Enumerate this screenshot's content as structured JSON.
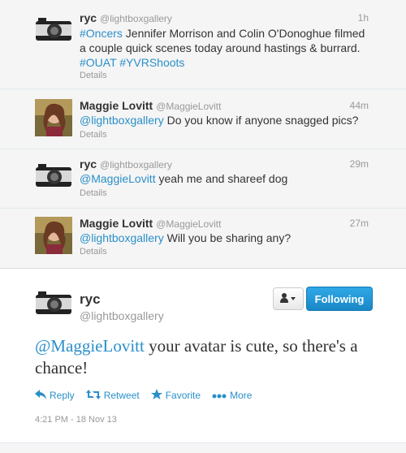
{
  "conversation": [
    {
      "name": "ryc",
      "handle": "@lightboxgallery",
      "time": "1h",
      "text_parts": [
        "#Oncers",
        " Jennifer Morrison and Colin O'Donoghue filmed a couple quick scenes today around hastings & burrard. ",
        "#OUAT #YVRShoots"
      ],
      "details": "Details",
      "avatar": "camera-avatar"
    },
    {
      "name": "Maggie Lovitt",
      "handle": "@MaggieLovitt",
      "time": "44m",
      "text_parts": [
        "@lightboxgallery",
        " Do you know if anyone snagged pics?"
      ],
      "details": "Details",
      "avatar": "person-avatar"
    },
    {
      "name": "ryc",
      "handle": "@lightboxgallery",
      "time": "29m",
      "text_parts": [
        "@MaggieLovitt",
        " yeah me and shareef dog"
      ],
      "details": "Details",
      "avatar": "camera-avatar"
    },
    {
      "name": "Maggie Lovitt",
      "handle": "@MaggieLovitt",
      "time": "27m",
      "text_parts": [
        "@lightboxgallery",
        " Will you be sharing any?"
      ],
      "details": "Details",
      "avatar": "person-avatar"
    }
  ],
  "main_tweet": {
    "name": "ryc",
    "handle": "@lightboxgallery",
    "mention": "@MaggieLovitt",
    "text": " your avatar is cute, so there's a chance!",
    "follow_label": "Following",
    "menu_icon": "user-menu-icon",
    "actions": {
      "reply": "Reply",
      "retweet": "Retweet",
      "favorite": "Favorite",
      "more": "More"
    },
    "timestamp": "4:21 PM - 18 Nov 13"
  },
  "colors": {
    "link": "#2a8fc9",
    "follow_button": "#2fa8e7"
  }
}
